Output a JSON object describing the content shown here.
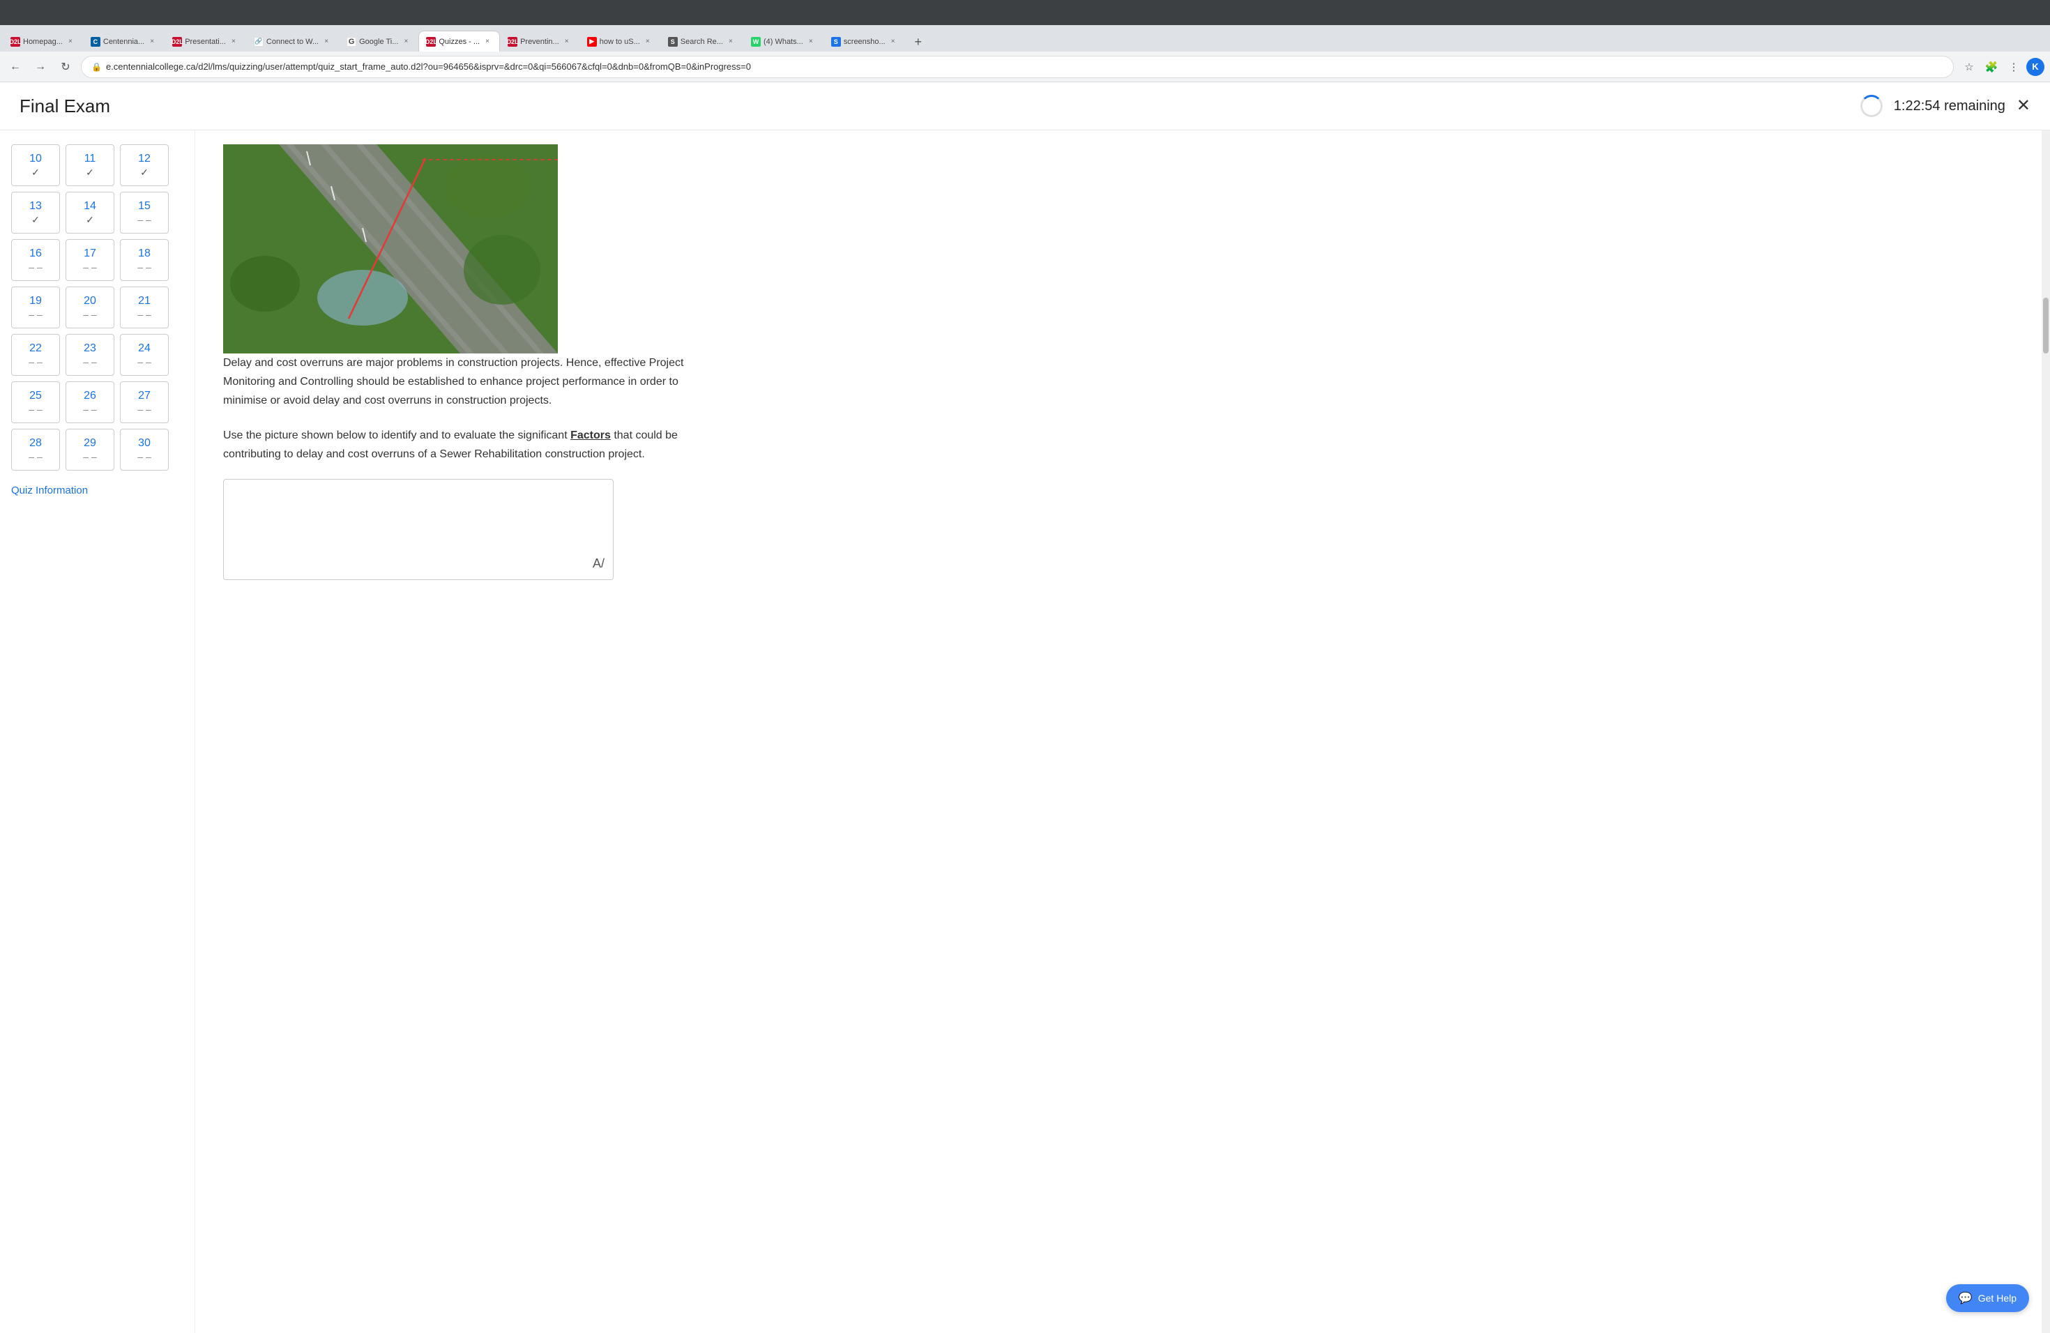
{
  "browser": {
    "tabs": [
      {
        "id": "homepage",
        "label": "Homepag...",
        "favicon_class": "fav-d2l",
        "favicon_text": "D2L",
        "active": false
      },
      {
        "id": "centennial",
        "label": "Centennia...",
        "favicon_class": "fav-centennial",
        "favicon_text": "C",
        "active": false
      },
      {
        "id": "presentation",
        "label": "Presentati...",
        "favicon_class": "fav-d2l",
        "favicon_text": "D2L",
        "active": false
      },
      {
        "id": "connect",
        "label": "Connect to W...",
        "favicon_class": "fav-google",
        "favicon_text": "🔗",
        "active": false
      },
      {
        "id": "google-t",
        "label": "Google Ti...",
        "favicon_class": "fav-google",
        "favicon_text": "G",
        "active": false
      },
      {
        "id": "quizzes",
        "label": "Quizzes - ...",
        "favicon_class": "fav-d2l",
        "favicon_text": "D2L",
        "active": true
      },
      {
        "id": "preventing",
        "label": "Preventin...",
        "favicon_class": "fav-d2l",
        "favicon_text": "D2L",
        "active": false
      },
      {
        "id": "how-to-us",
        "label": "how to uS...",
        "favicon_class": "fav-youtube",
        "favicon_text": "▶",
        "active": false
      },
      {
        "id": "search-re",
        "label": "Search Re...",
        "favicon_class": "fav-search",
        "favicon_text": "S",
        "active": false
      },
      {
        "id": "whats",
        "label": "(4) Whats...",
        "favicon_class": "fav-whatsapp",
        "favicon_text": "W",
        "active": false
      },
      {
        "id": "screenshot",
        "label": "screensho...",
        "favicon_class": "fav-screenshot",
        "favicon_text": "S",
        "active": false
      }
    ],
    "address": "e.centennialcollege.ca/d2l/lms/quizzing/user/attempt/quiz_start_frame_auto.d2l?ou=964656&isprv=&drc=0&qi=566067&cfql=0&dnb=0&fromQB=0&inProgress=0",
    "profile_letter": "K"
  },
  "exam": {
    "title": "Final Exam",
    "timer": "1:22:54 remaining"
  },
  "sidebar": {
    "questions": [
      {
        "num": "10",
        "status": "✓",
        "checked": true
      },
      {
        "num": "11",
        "status": "✓",
        "checked": true
      },
      {
        "num": "12",
        "status": "✓",
        "checked": true
      },
      {
        "num": "13",
        "status": "✓",
        "checked": true
      },
      {
        "num": "14",
        "status": "✓",
        "checked": true
      },
      {
        "num": "15",
        "status": "– –",
        "checked": false
      },
      {
        "num": "16",
        "status": "– –",
        "checked": false
      },
      {
        "num": "17",
        "status": "– –",
        "checked": false
      },
      {
        "num": "18",
        "status": "– –",
        "checked": false
      },
      {
        "num": "19",
        "status": "– –",
        "checked": false
      },
      {
        "num": "20",
        "status": "– –",
        "checked": false
      },
      {
        "num": "21",
        "status": "– –",
        "checked": false
      },
      {
        "num": "22",
        "status": "– –",
        "checked": false
      },
      {
        "num": "23",
        "status": "– –",
        "checked": false
      },
      {
        "num": "24",
        "status": "– –",
        "checked": false
      },
      {
        "num": "25",
        "status": "– –",
        "checked": false
      },
      {
        "num": "26",
        "status": "– –",
        "checked": false
      },
      {
        "num": "27",
        "status": "– –",
        "checked": false
      },
      {
        "num": "28",
        "status": "– –",
        "checked": false
      },
      {
        "num": "29",
        "status": "– –",
        "checked": false
      },
      {
        "num": "30",
        "status": "– –",
        "checked": false
      }
    ],
    "quiz_info_label": "Quiz Information"
  },
  "content": {
    "paragraph1": "Delay and cost overruns are major problems in construction projects. Hence, effective Project Monitoring and Controlling should be established to enhance project performance in order to minimise or avoid delay and cost overruns in construction projects.",
    "paragraph2_prefix": "Use the picture shown below to identify and to evaluate the significant ",
    "paragraph2_bold": "Factors",
    "paragraph2_suffix": " that could be contributing to delay and cost overruns of a Sewer Rehabilitation construction project."
  },
  "help": {
    "label": "Get Help"
  }
}
